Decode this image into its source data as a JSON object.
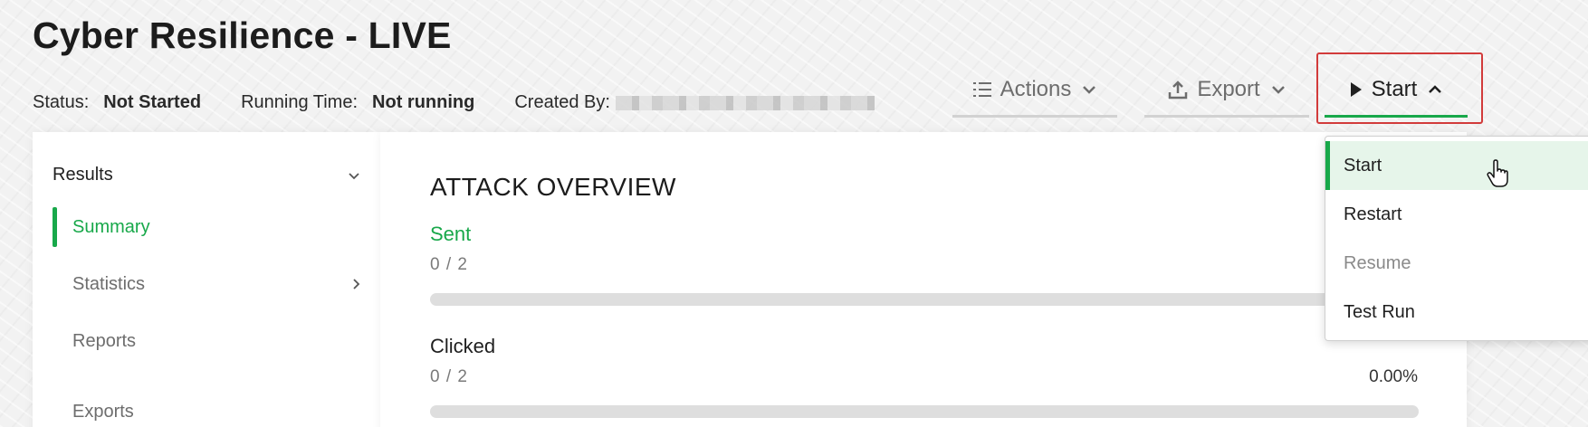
{
  "page": {
    "title": "Cyber Resilience - LIVE"
  },
  "meta": {
    "status_label": "Status:",
    "status_value": "Not Started",
    "running_label": "Running Time:",
    "running_value": "Not running",
    "created_label": "Created By:"
  },
  "toolbar": {
    "actions_label": "Actions",
    "export_label": "Export",
    "start_label": "Start"
  },
  "start_menu": {
    "items": [
      {
        "label": "Start",
        "state": "selected"
      },
      {
        "label": "Restart",
        "state": "enabled"
      },
      {
        "label": "Resume",
        "state": "disabled"
      },
      {
        "label": "Test Run",
        "state": "enabled"
      }
    ]
  },
  "sidebar": {
    "header": "Results",
    "items": [
      {
        "label": "Summary",
        "active": true
      },
      {
        "label": "Statistics",
        "has_submenu": true
      },
      {
        "label": "Reports"
      },
      {
        "label": "Exports"
      }
    ]
  },
  "overview": {
    "title": "ATTACK OVERVIEW",
    "metrics": [
      {
        "label": "Sent",
        "count": "0 / 2",
        "percent": "",
        "progress": 0,
        "accent": "#18a84a"
      },
      {
        "label": "Clicked",
        "count": "0 / 2",
        "percent": "0.00%",
        "progress": 0,
        "accent": "#1f1f1f"
      }
    ]
  },
  "colors": {
    "accent": "#18a84a",
    "highlight_border": "#d23b3b"
  }
}
